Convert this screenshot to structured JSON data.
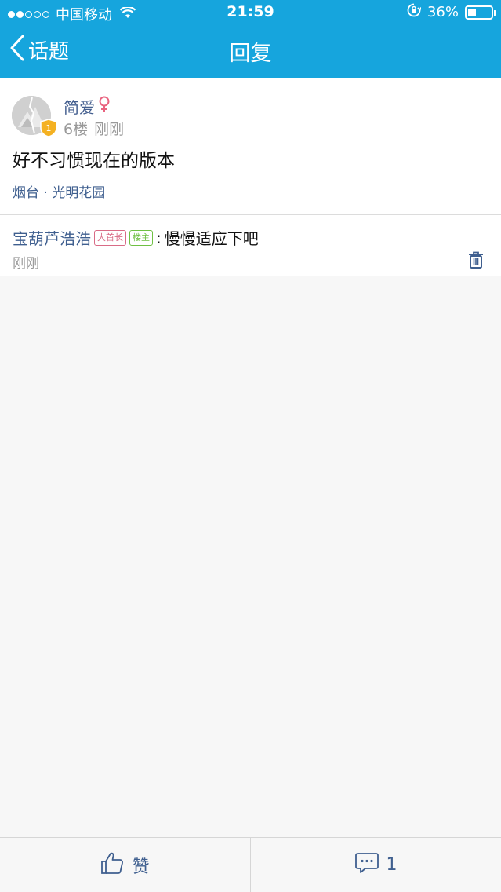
{
  "status_bar": {
    "signal_filled": 2,
    "signal_total": 5,
    "carrier": "中国移动",
    "time": "21:59",
    "battery_percent": "36%",
    "battery_level": 0.36
  },
  "nav": {
    "back_label": "话题",
    "title": "回复"
  },
  "post": {
    "author": "简爱",
    "gender": "female",
    "level_badge": "1",
    "floor": "6楼",
    "time": "刚刚",
    "content": "好不习惯现在的版本",
    "location": "烟台 · 光明花园"
  },
  "reply": {
    "user": "宝葫芦浩浩",
    "tags": [
      "大首长",
      "楼主"
    ],
    "separator": ":",
    "text": "慢慢适应下吧",
    "time": "刚刚"
  },
  "bottom_bar": {
    "like_label": "赞",
    "comment_count": "1"
  },
  "colors": {
    "header_bg": "#16a5dd",
    "link_blue": "#3f5f8f",
    "female_pink": "#e9637f",
    "badge_gold": "#f4b122",
    "tag_chief": "#d96b86",
    "tag_op": "#6fc043"
  }
}
